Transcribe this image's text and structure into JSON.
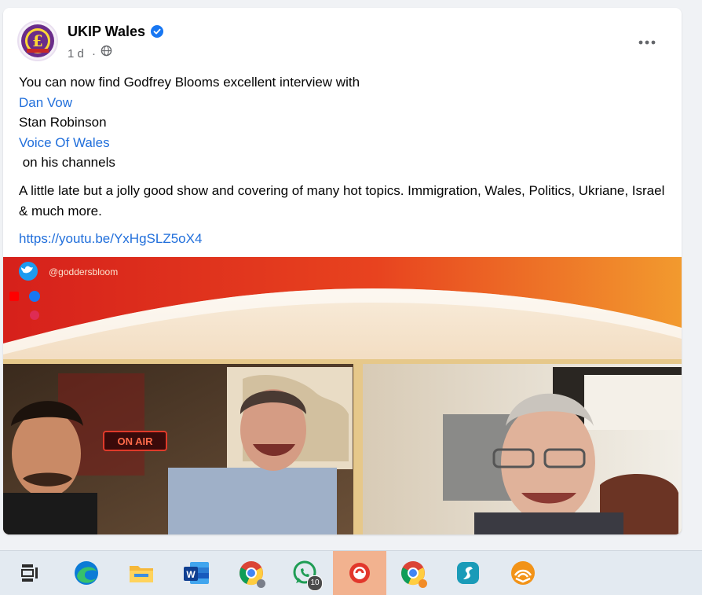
{
  "post": {
    "page_name": "UKIP Wales",
    "time": "1 d",
    "separator": "·",
    "text_intro": "You can now find Godfrey Blooms excellent interview with",
    "mention_1": "Dan Vow",
    "line_stan": "Stan Robinson",
    "mention_2": "Voice Of Wales",
    "line_channels": " on his channels",
    "paragraph_2": "A little late but a jolly good show and covering of many hot topics. Immigration, Wales, Politics, Ukriane, Israel & much more.",
    "link": "https://youtu.be/YxHgSLZ5oX4"
  },
  "media": {
    "twitter_handle": "@goddersbloom",
    "on_air_label": "ON AIR"
  },
  "taskbar": {
    "items": [
      {
        "icon": "task-view-icon"
      },
      {
        "icon": "edge-icon"
      },
      {
        "icon": "file-explorer-icon"
      },
      {
        "icon": "word-icon"
      },
      {
        "icon": "chrome-icon"
      },
      {
        "icon": "whatsapp-icon",
        "badge": "10"
      },
      {
        "icon": "app-icon"
      },
      {
        "icon": "chrome-profile-icon"
      },
      {
        "icon": "surfshark-icon"
      },
      {
        "icon": "audible-icon"
      }
    ]
  },
  "colors": {
    "link": "#216fdb",
    "verified": "#1877f2",
    "taskbar_active": "#f2b28f"
  }
}
